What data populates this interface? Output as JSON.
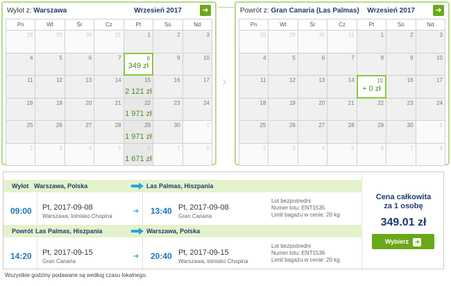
{
  "outbound_calendar": {
    "title_prefix": "Wylot z:",
    "title_city": "Warszawa",
    "month": "Wrzesień 2017",
    "weekdays": [
      "Pn",
      "Wt",
      "Śr",
      "Cz",
      "Pt",
      "So",
      "Nd"
    ],
    "weeks": [
      [
        {
          "d": "28",
          "out": true
        },
        {
          "d": "29",
          "out": true
        },
        {
          "d": "30",
          "out": true
        },
        {
          "d": "31",
          "out": true
        },
        {
          "d": "1"
        },
        {
          "d": "2"
        },
        {
          "d": "3"
        }
      ],
      [
        {
          "d": "4"
        },
        {
          "d": "5"
        },
        {
          "d": "6"
        },
        {
          "d": "7"
        },
        {
          "d": "8",
          "price": "349 zł",
          "selected": true
        },
        {
          "d": "9"
        },
        {
          "d": "10"
        }
      ],
      [
        {
          "d": "11"
        },
        {
          "d": "12"
        },
        {
          "d": "13"
        },
        {
          "d": "14"
        },
        {
          "d": "15",
          "price": "2 121 zł"
        },
        {
          "d": "16"
        },
        {
          "d": "17"
        }
      ],
      [
        {
          "d": "18"
        },
        {
          "d": "19"
        },
        {
          "d": "20"
        },
        {
          "d": "21"
        },
        {
          "d": "22",
          "price": "1 971 zł"
        },
        {
          "d": "23"
        },
        {
          "d": "24"
        }
      ],
      [
        {
          "d": "25"
        },
        {
          "d": "26"
        },
        {
          "d": "27"
        },
        {
          "d": "28"
        },
        {
          "d": "29",
          "price": "1 971 zł"
        },
        {
          "d": "30"
        },
        {
          "d": "1",
          "out": true
        }
      ],
      [
        {
          "d": "2",
          "out": true
        },
        {
          "d": "3",
          "out": true
        },
        {
          "d": "4",
          "out": true
        },
        {
          "d": "5",
          "out": true
        },
        {
          "d": "6",
          "out": true,
          "price": "1 671 zł"
        },
        {
          "d": "7",
          "out": true
        },
        {
          "d": "8",
          "out": true
        }
      ]
    ]
  },
  "return_calendar": {
    "title_prefix": "Powrót z:",
    "title_city": "Gran Canaria (Las Palmas)",
    "month": "Wrzesień 2017",
    "weekdays": [
      "Pn",
      "Wt",
      "Śr",
      "Cz",
      "Pt",
      "So",
      "Nd"
    ],
    "weeks": [
      [
        {
          "d": "28",
          "out": true
        },
        {
          "d": "29",
          "out": true
        },
        {
          "d": "30",
          "out": true
        },
        {
          "d": "31",
          "out": true
        },
        {
          "d": "1"
        },
        {
          "d": "2"
        },
        {
          "d": "3"
        }
      ],
      [
        {
          "d": "4"
        },
        {
          "d": "5"
        },
        {
          "d": "6"
        },
        {
          "d": "7"
        },
        {
          "d": "8"
        },
        {
          "d": "9"
        },
        {
          "d": "10"
        }
      ],
      [
        {
          "d": "11"
        },
        {
          "d": "12"
        },
        {
          "d": "13"
        },
        {
          "d": "14"
        },
        {
          "d": "15",
          "price": "+ 0 zł",
          "selected": true
        },
        {
          "d": "16"
        },
        {
          "d": "17"
        }
      ],
      [
        {
          "d": "18"
        },
        {
          "d": "19"
        },
        {
          "d": "20"
        },
        {
          "d": "21"
        },
        {
          "d": "22"
        },
        {
          "d": "23"
        },
        {
          "d": "24"
        }
      ],
      [
        {
          "d": "25"
        },
        {
          "d": "26"
        },
        {
          "d": "27"
        },
        {
          "d": "28"
        },
        {
          "d": "29"
        },
        {
          "d": "30"
        },
        {
          "d": "1",
          "out": true
        }
      ],
      [
        {
          "d": "2",
          "out": true
        },
        {
          "d": "3",
          "out": true
        },
        {
          "d": "4",
          "out": true
        },
        {
          "d": "5",
          "out": true
        },
        {
          "d": "6",
          "out": true
        },
        {
          "d": "7",
          "out": true
        },
        {
          "d": "8",
          "out": true
        }
      ]
    ]
  },
  "outbound": {
    "label": "Wylot",
    "from": "Warszawa, Polska",
    "to": "Las Palmas, Hiszpania",
    "dep_time": "09:00",
    "dep_date": "Pt, 2017-09-08",
    "dep_place": "Warszawa, lotnisko Chopina",
    "arr_time": "13:40",
    "arr_date": "Pt, 2017-09-08",
    "arr_place": "Gran Canaria",
    "info_direct": "Lot bezpośredni",
    "info_flight": "Numer lotu: ENT1535",
    "info_baggage": "Limit bagażu w cenie: 20 kg"
  },
  "return": {
    "label": "Powrót",
    "from": "Las Palmas, Hiszpania",
    "to": "Warszawa, Polska",
    "dep_time": "14:20",
    "dep_date": "Pt, 2017-09-15",
    "dep_place": "Gran Canaria",
    "arr_time": "20:40",
    "arr_date": "Pt, 2017-09-15",
    "arr_place": "Warszawa, lotnisko Chopina",
    "info_direct": "Lot bezpośredni",
    "info_flight": "Numer lotu: ENT1536",
    "info_baggage": "Limit bagażu w cenie: 20 kg"
  },
  "price_panel": {
    "label_line1": "Cena całkowita",
    "label_line2": "za 1 osobę",
    "price": "349.01 zł",
    "button": "Wybierz"
  },
  "footnote": "Wszystkie godziny podawane są według czasu lokalnego.",
  "colors": {
    "accent_green": "#6aa81a",
    "calendar_border": "#b5d98a",
    "link_blue": "#1a75bb",
    "navy": "#1e3c6e"
  },
  "icons": {
    "next_month": "arrow-right-icon",
    "route": "arrow-right-icon"
  }
}
